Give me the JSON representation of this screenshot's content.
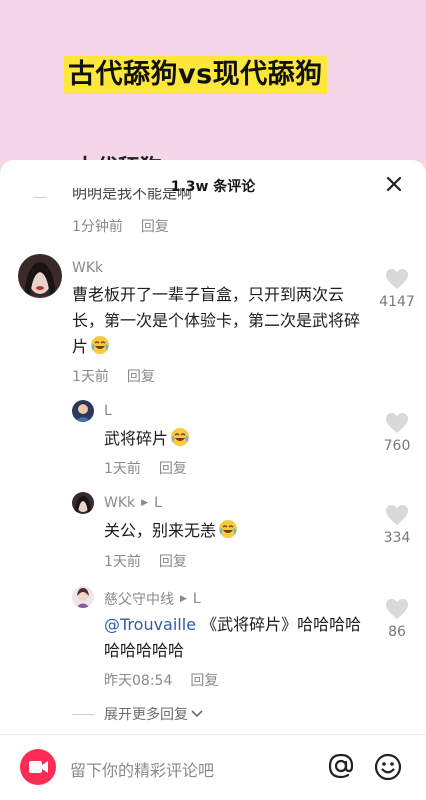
{
  "video": {
    "title": "古代舔狗vs现代舔狗",
    "subtitle": "古代舔狗"
  },
  "sheet": {
    "title": "1.3w 条评论",
    "clipped_comment_text": "明明是我不能是啊",
    "clipped_comment_time": "1分钟前",
    "reply_label": "回复"
  },
  "comments": [
    {
      "username": "WKk",
      "text": "曹老板开了一辈子盲盒，只开到两次云长，第一次是个体验卡，第二次是武将碎片",
      "time": "1天前",
      "likes": "4147"
    }
  ],
  "replies": [
    {
      "username": "L",
      "reply_to": "",
      "text": "武将碎片",
      "time": "1天前",
      "likes": "760"
    },
    {
      "username": "WKk",
      "reply_to": "L",
      "text": "关公，别来无恙",
      "time": "1天前",
      "likes": "334"
    },
    {
      "username": "慈父守中线",
      "reply_to": "L",
      "mention": "@Trouvaille",
      "text": " 《武将碎片》哈哈哈哈哈哈哈哈哈",
      "time": "昨天08:54",
      "likes": "86"
    }
  ],
  "expand_more": "展开更多回复",
  "input": {
    "placeholder": "留下你的精彩评论吧"
  },
  "colors": {
    "accent": "#fe2c55",
    "mention": "#2f5ba8",
    "title_highlight": "#fde73b",
    "background": "#f5d6e8"
  },
  "icons": [
    "close-icon",
    "heart-icon",
    "crying-laughing-emoji",
    "camera-icon",
    "at-icon",
    "emoji-icon",
    "chevron-down-icon"
  ]
}
